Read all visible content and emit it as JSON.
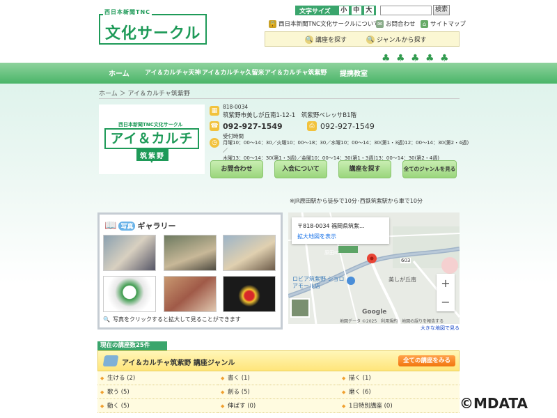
{
  "header": {
    "logo_tag": "西日本新聞TNC",
    "logo_main": "文化サークル",
    "fontsize_label": "文字サイズ",
    "fontsize_small": "小",
    "fontsize_medium": "中",
    "fontsize_large": "大",
    "search_button": "検索",
    "links": {
      "about": "西日本新聞TNC文化サークルについて",
      "contact": "お問合わせ",
      "sitemap": "サイトマップ"
    },
    "find_course": "講座を探す",
    "find_genre": "ジャンルから探す"
  },
  "nav": {
    "home": "ホーム",
    "tenjin": "アイ＆カルチャ天神",
    "kurume": "アイ＆カルチャ久留米",
    "chikushino": "アイ＆カルチャ筑紫野",
    "partner": "提携教室"
  },
  "breadcrumb": "ホーム ＞ アイ＆カルチャ筑紫野",
  "school": {
    "logo_tag": "西日本新聞TNC文化サークル",
    "logo_main": "アイ＆カルチャ",
    "logo_sub": "筑紫野",
    "postal": "818-0034",
    "address": "筑紫野市美しが丘南1-12-1　筑紫野ベレッサB1階",
    "phone": "092-927-1549",
    "fax": "092-927-1549",
    "hours_label": "受付時間",
    "hours_1": "月曜10：00～14：30／火曜10：00～18：30／水曜10：00～14：30(第1・3週)12：00～14：30(第2・4週)／",
    "hours_2": "木曜13：00～14：30(第1・3週)／金曜10：00～14：30(第1・3週)13：00～14：30(第2・4週)"
  },
  "buttons": {
    "contact": "お問合わせ",
    "join": "入会について",
    "find": "講座を探す",
    "genres": "全てのジャンルを見る"
  },
  "access": "※JR原田駅から徒歩で10分･西鉄筑紫駅から車で10分",
  "gallery": {
    "badge": "写真",
    "title": "ギャラリー",
    "note": "写真をクリックすると拡大して見ることができます"
  },
  "map": {
    "address": "〒818-0034 福岡県筑紫...",
    "enlarge": "拡大地図を表示",
    "large_map": "大きな地図で見る",
    "footer": "地図データ ©2025　利用規約　地図の誤りを報告する",
    "label_station": "ロビア筑紫野 ショロアモール店",
    "label_area": "美しが丘南",
    "label_route": "603",
    "label_ic": "原田IC"
  },
  "courses": {
    "count": "現在の講座数25件",
    "genre_title": "アイ＆カルチャ筑紫野 講座ジャンル",
    "all_courses": "全ての講座をみる",
    "genres": [
      "生ける (2)",
      "書く (1)",
      "描く (1)",
      "歌う (5)",
      "創る (5)",
      "磨く (6)",
      "動く (5)",
      "伸ばす (0)",
      "1日特別講座 (0)"
    ]
  },
  "copyright": "©MDATA",
  "colors": {
    "brand_green": "#1e9a58",
    "nav_green": "#4ab568",
    "accent_orange": "#f2760f"
  }
}
